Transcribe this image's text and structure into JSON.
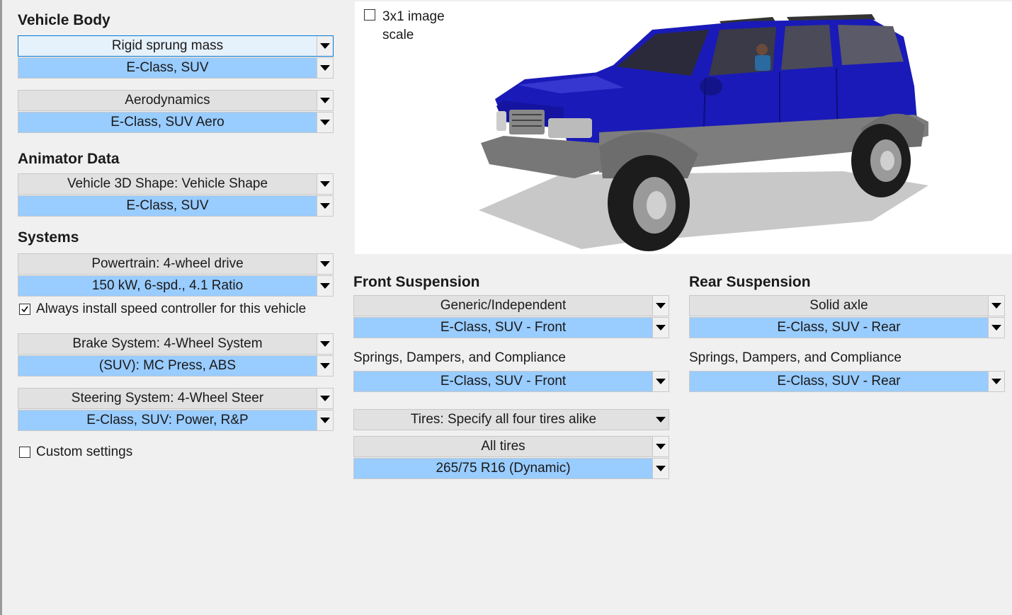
{
  "vehicle_body": {
    "heading": "Vehicle Body",
    "sprung_mass_type": "Rigid sprung mass",
    "sprung_mass_dataset": "E-Class, SUV",
    "aero_type": "Aerodynamics",
    "aero_dataset": "E-Class, SUV Aero"
  },
  "animator": {
    "heading": "Animator Data",
    "shape_type": "Vehicle 3D Shape: Vehicle Shape",
    "shape_dataset": "E-Class, SUV"
  },
  "systems": {
    "heading": "Systems",
    "powertrain_type": "Powertrain: 4-wheel drive",
    "powertrain_dataset": "150 kW, 6-spd., 4.1 Ratio",
    "speed_controller_label": "Always install speed controller for this vehicle",
    "speed_controller_checked": true,
    "brake_type": "Brake System: 4-Wheel System",
    "brake_dataset": "(SUV): MC Press, ABS",
    "steering_type": "Steering System: 4-Wheel Steer",
    "steering_dataset": "E-Class, SUV: Power, R&P",
    "custom_settings_label": "Custom settings",
    "custom_settings_checked": false
  },
  "image_panel": {
    "scale_label_line1": "3x1 image",
    "scale_label_line2": "scale",
    "scale_checked": false,
    "vehicle_color": "#1a1ab8"
  },
  "front_suspension": {
    "heading": "Front Suspension",
    "kinematics_type": "Generic/Independent",
    "kinematics_dataset": "E-Class, SUV - Front",
    "compliance_label": "Springs, Dampers, and Compliance",
    "compliance_dataset": "E-Class, SUV - Front"
  },
  "rear_suspension": {
    "heading": "Rear Suspension",
    "kinematics_type": "Solid axle",
    "kinematics_dataset": "E-Class, SUV - Rear",
    "compliance_label": "Springs, Dampers, and Compliance",
    "compliance_dataset": "E-Class, SUV - Rear"
  },
  "tires": {
    "mode": "Tires: Specify all four tires alike",
    "group": "All tires",
    "dataset": "265/75 R16 (Dynamic)"
  },
  "colors": {
    "dataset_highlight": "#99ccff",
    "type_gray": "#e1e1e1",
    "background": "#f0f0f0"
  }
}
